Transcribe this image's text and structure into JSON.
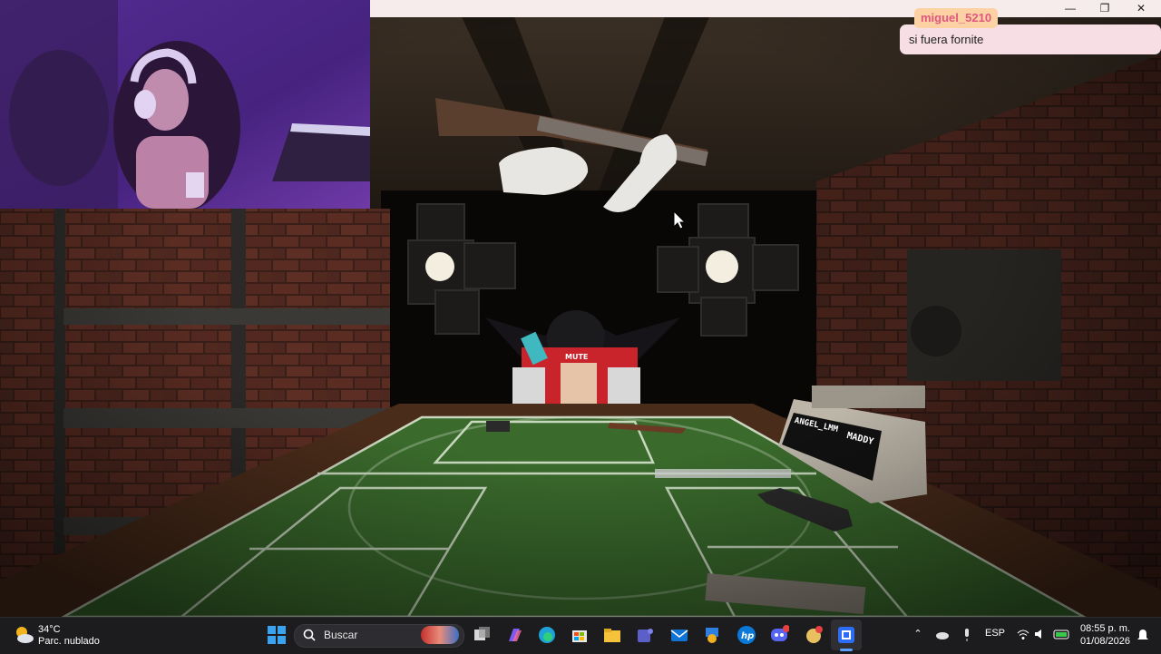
{
  "stream_chat": {
    "username": "miguel_5210",
    "message": "si fuera fornite"
  },
  "game": {
    "player_tag": "MUTE",
    "device_label_left": "ANGEL_LMM",
    "device_label_right": "MADDY"
  },
  "window_controls": {
    "minimize": "—",
    "maximize": "❐",
    "close": "✕"
  },
  "taskbar": {
    "weather_temp": "34°C",
    "weather_desc": "Parc. nublado",
    "search_placeholder": "Buscar",
    "language": "ESP",
    "time": "08:55 p. m.",
    "date": "01/08/2026"
  },
  "icons": {
    "weather": "partly-cloudy-icon",
    "start": "windows-start-icon",
    "search": "search-icon"
  },
  "colors": {
    "chat_username": "#e0567e",
    "chat_bubble": "#f7dde4",
    "felt_green": "#3a6a2c",
    "taskbar": "#1c1c1f"
  }
}
